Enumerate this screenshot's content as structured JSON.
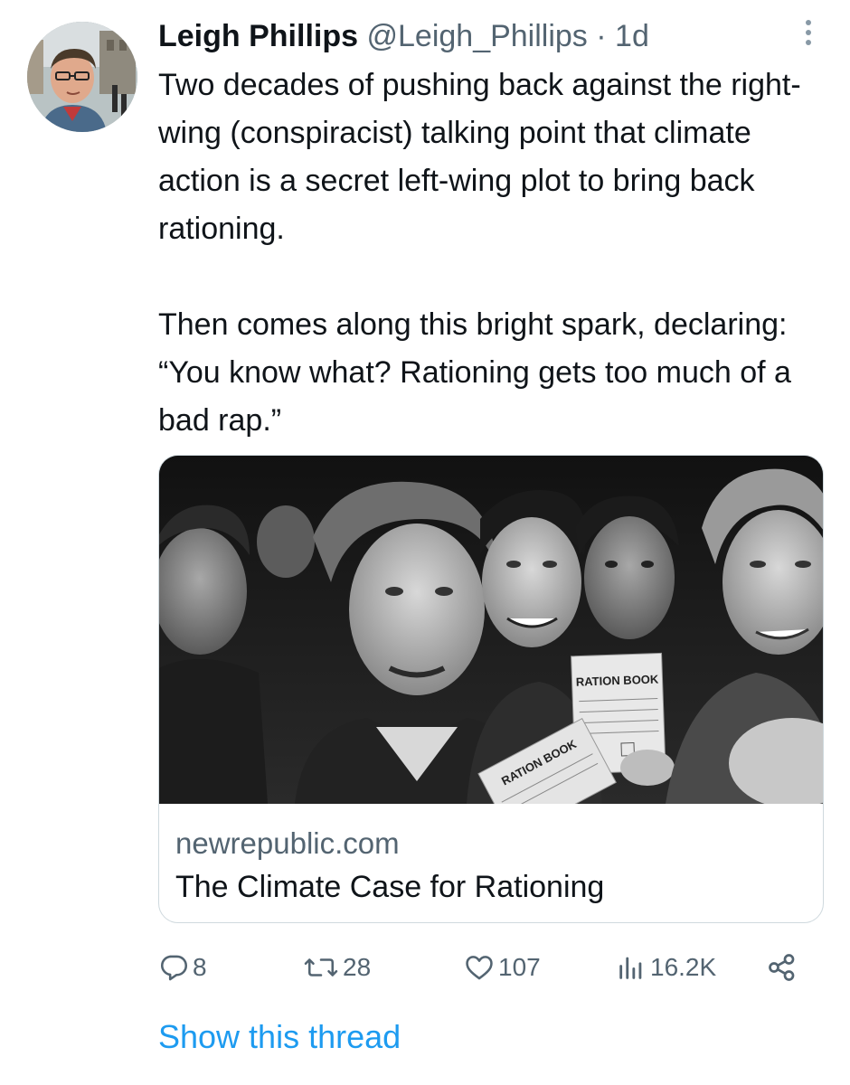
{
  "tweet": {
    "author_name": "Leigh Phillips",
    "author_handle": "@Leigh_Phillips",
    "separator": "·",
    "timestamp": "1d",
    "text_paragraphs": [
      "Two decades of pushing back against the right-wing (conspiracist) talking point that climate action is a secret left-wing plot to bring back rationing.",
      "Then comes along this bright spark, declaring: “You know what? Rationing gets too much of a bad rap.”"
    ]
  },
  "link_card": {
    "domain": "newrepublic.com",
    "title": "The Climate Case for Rationing",
    "image_text_1": "RATION BOOK",
    "image_text_2": "RATION BOOK"
  },
  "actions": {
    "replies": "8",
    "retweets": "28",
    "likes": "107",
    "views": "16.2K"
  },
  "show_thread": "Show this thread",
  "icons": {
    "reply": "reply-icon",
    "retweet": "retweet-icon",
    "like": "heart-icon",
    "views": "analytics-icon",
    "share": "share-icon",
    "more": "more-options-icon"
  },
  "colors": {
    "link_blue": "#1d9bf0",
    "secondary_gray": "#536471",
    "text_black": "#0f1419"
  }
}
